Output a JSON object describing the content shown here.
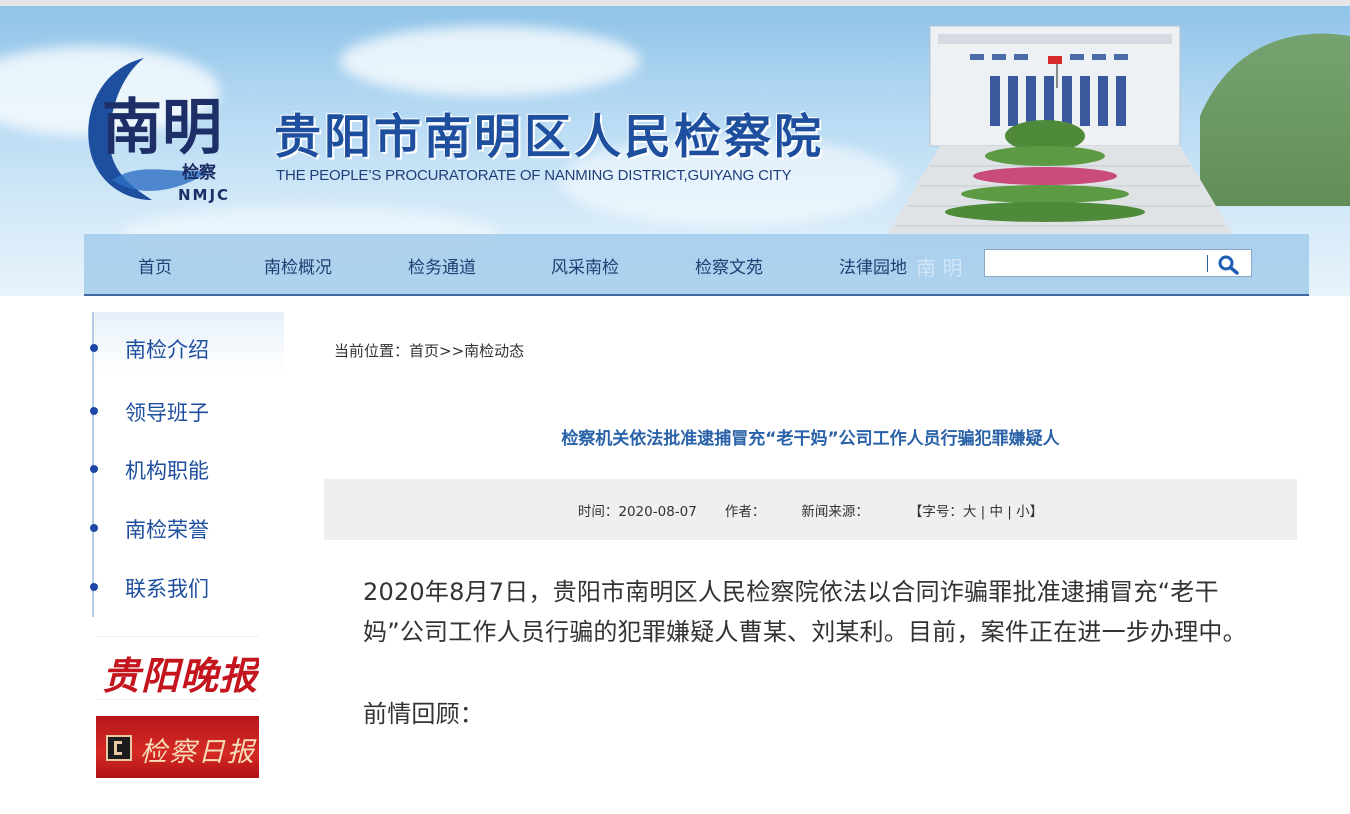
{
  "header": {
    "logo_text": "南明",
    "logo_small": "检察",
    "logo_abbr": "NMJC",
    "title": "贵阳市南明区人民检察院",
    "subtitle": "THE PEOPLE’S PROCURATORATE OF NANMING DISTRICT,GUIYANG CITY"
  },
  "nav": {
    "items": [
      {
        "label": "首页"
      },
      {
        "label": "南检概况"
      },
      {
        "label": "检务通道"
      },
      {
        "label": "风采南检"
      },
      {
        "label": "检察文苑"
      },
      {
        "label": "法律园地"
      }
    ],
    "watermark": "南 明",
    "search_value": ""
  },
  "sidebar": {
    "items": [
      {
        "label": "南检介绍"
      },
      {
        "label": "领导班子"
      },
      {
        "label": "机构职能"
      },
      {
        "label": "南检荣誉"
      },
      {
        "label": "联系我们"
      }
    ],
    "ads": [
      {
        "text": "贵阳晚报"
      },
      {
        "text": "检察日报"
      }
    ]
  },
  "breadcrumb": {
    "prefix": "当前位置：",
    "home": "首页",
    "sep": ">>",
    "current": "南检动态"
  },
  "article": {
    "title": "检察机关依法批准逮捕冒充“老干妈”公司工作人员行骗犯罪嫌疑人",
    "meta": {
      "time_label": "时间：",
      "time_value": "2020-08-07",
      "author_label": "作者：",
      "source_label": "新闻来源：",
      "fontsize_prefix": "【字号：",
      "fs_large": "大",
      "fs_medium": "中",
      "fs_small": "小",
      "fontsize_suffix": "】",
      "divider": " | "
    },
    "paragraphs": [
      "2020年8月7日，贵阳市南明区人民检察院依法以合同诈骗罪批准逮捕冒充“老干妈”公司工作人员行骗的犯罪嫌疑人曹某、刘某利。目前，案件正在进一步办理中。",
      "前情回顾："
    ]
  },
  "colors": {
    "brand_blue": "#1d4f9e",
    "title_blue": "#2a62a8",
    "nav_bg": "#a5cdec",
    "ad_red": "#c4141e"
  },
  "icons": {
    "search": "search-icon",
    "bullet": "dot-icon"
  }
}
